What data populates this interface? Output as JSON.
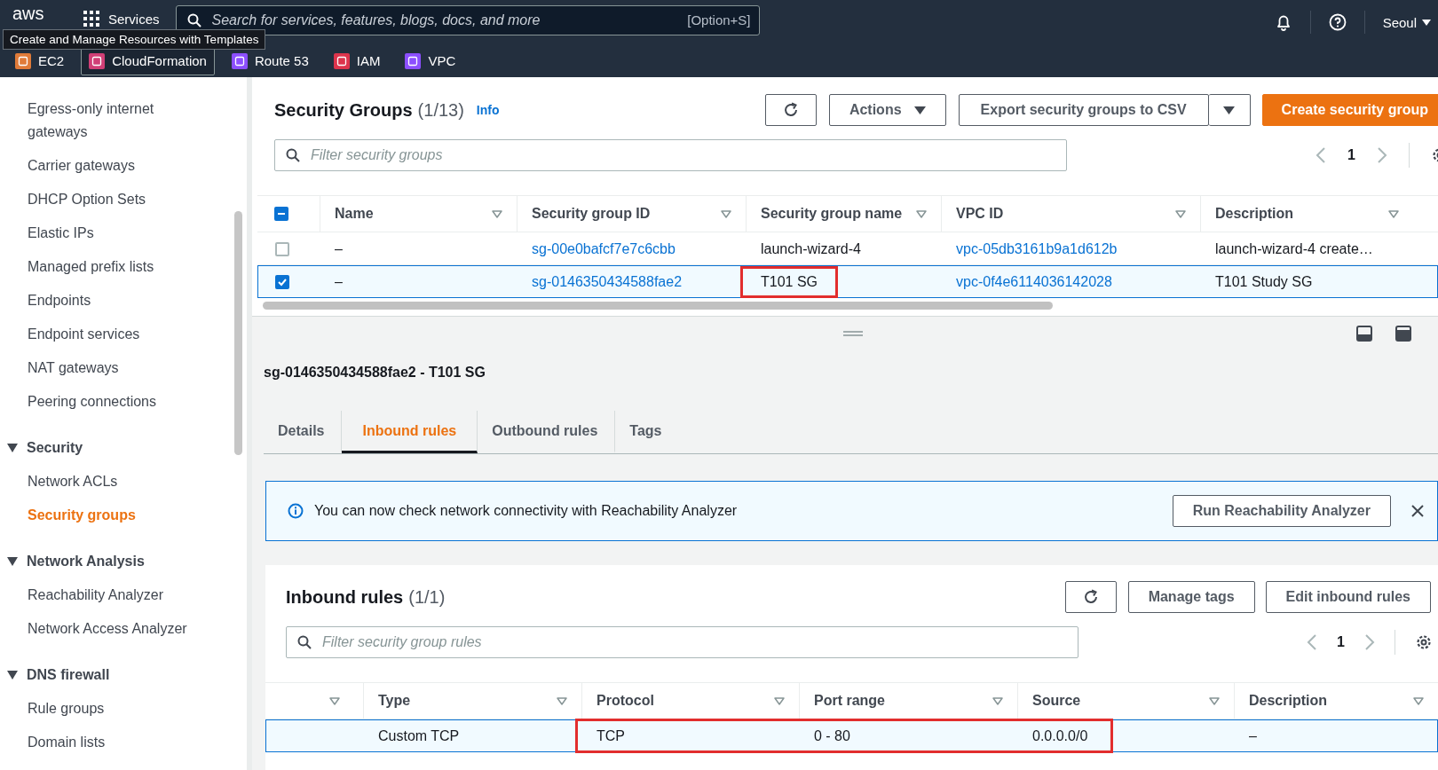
{
  "nav": {
    "logo": "aws",
    "services": "Services",
    "search_placeholder": "Search for services, features, blogs, docs, and more",
    "search_shortcut": "[Option+S]",
    "region": "Seoul"
  },
  "tooltip": "Create and Manage Resources with Templates",
  "favorites": [
    {
      "label": "EC2",
      "color": "#e07b39",
      "selected": false
    },
    {
      "label": "CloudFormation",
      "color": "#d13f76",
      "selected": true
    },
    {
      "label": "Route 53",
      "color": "#8c4fff",
      "selected": false
    },
    {
      "label": "IAM",
      "color": "#dd344c",
      "selected": false
    },
    {
      "label": "VPC",
      "color": "#8c4fff",
      "selected": false
    }
  ],
  "sidebar": [
    {
      "kind": "item",
      "label": "Egress-only internet gateways",
      "selected": false
    },
    {
      "kind": "item",
      "label": "Carrier gateways",
      "selected": false
    },
    {
      "kind": "item",
      "label": "DHCP Option Sets",
      "selected": false
    },
    {
      "kind": "item",
      "label": "Elastic IPs",
      "selected": false
    },
    {
      "kind": "item",
      "label": "Managed prefix lists",
      "selected": false
    },
    {
      "kind": "item",
      "label": "Endpoints",
      "selected": false
    },
    {
      "kind": "item",
      "label": "Endpoint services",
      "selected": false
    },
    {
      "kind": "item",
      "label": "NAT gateways",
      "selected": false
    },
    {
      "kind": "item",
      "label": "Peering connections",
      "selected": false
    },
    {
      "kind": "section",
      "label": "Security",
      "expanded": true,
      "children": [
        {
          "label": "Network ACLs",
          "selected": false
        },
        {
          "label": "Security groups",
          "selected": true
        }
      ]
    },
    {
      "kind": "section",
      "label": "Network Analysis",
      "expanded": true,
      "children": [
        {
          "label": "Reachability Analyzer",
          "selected": false
        },
        {
          "label": "Network Access Analyzer",
          "selected": false
        }
      ]
    },
    {
      "kind": "section",
      "label": "DNS firewall",
      "expanded": true,
      "children": [
        {
          "label": "Rule groups",
          "selected": false
        },
        {
          "label": "Domain lists",
          "selected": false
        }
      ]
    }
  ],
  "security_groups": {
    "title": "Security Groups",
    "count": "(1/13)",
    "info": "Info",
    "actions": "Actions",
    "export": "Export security groups to CSV",
    "create": "Create security group",
    "filter_placeholder": "Filter security groups",
    "page": "1",
    "select_all": {
      "checked": true,
      "indeterminate": true
    },
    "columns": [
      "Name",
      "Security group ID",
      "Security group name",
      "VPC ID",
      "Description"
    ],
    "rows": [
      {
        "selected": false,
        "cells": [
          {
            "text": "–",
            "kind": "text",
            "highlighted": false
          },
          {
            "text": "sg-00e0bafcf7e7c6cbb",
            "kind": "link",
            "highlighted": false
          },
          {
            "text": "launch-wizard-4",
            "kind": "text",
            "highlighted": false
          },
          {
            "text": "vpc-05db3161b9a1d612b",
            "kind": "link",
            "highlighted": false
          },
          {
            "text": "launch-wizard-4 create…",
            "kind": "text",
            "highlighted": false
          }
        ]
      },
      {
        "selected": true,
        "cells": [
          {
            "text": "–",
            "kind": "text",
            "highlighted": false
          },
          {
            "text": "sg-0146350434588fae2",
            "kind": "link",
            "highlighted": false
          },
          {
            "text": "T101 SG",
            "kind": "text",
            "highlighted": true
          },
          {
            "text": "vpc-0f4e6114036142028",
            "kind": "link",
            "highlighted": false
          },
          {
            "text": "T101 Study SG",
            "kind": "text",
            "highlighted": false
          }
        ]
      }
    ]
  },
  "details": {
    "title": "sg-0146350434588fae2 - T101 SG",
    "tabs": [
      {
        "label": "Details",
        "selected": false
      },
      {
        "label": "Inbound rules",
        "selected": true
      },
      {
        "label": "Outbound rules",
        "selected": false
      },
      {
        "label": "Tags",
        "selected": false
      }
    ],
    "alert": {
      "text": "You can now check network connectivity with Reachability Analyzer",
      "button": "Run Reachability Analyzer"
    },
    "inbound": {
      "title": "Inbound rules",
      "count": "(1/1)",
      "manage": "Manage tags",
      "edit": "Edit inbound rules",
      "filter_placeholder": "Filter security group rules",
      "page": "1",
      "columns": [
        "Type",
        "Protocol",
        "Port range",
        "Source",
        "Description"
      ],
      "rows": [
        {
          "selected": true,
          "cells": [
            {
              "text": "Custom TCP",
              "highlighted": false
            },
            {
              "text": "TCP",
              "highlighted": true
            },
            {
              "text": "0 - 80",
              "highlighted": true
            },
            {
              "text": "0.0.0.0/0",
              "highlighted": true
            },
            {
              "text": "–",
              "highlighted": false
            }
          ]
        }
      ]
    }
  }
}
